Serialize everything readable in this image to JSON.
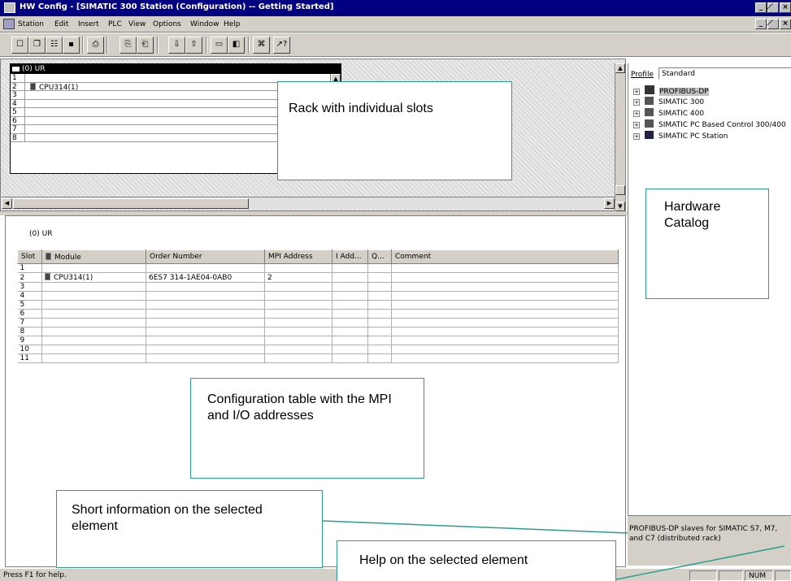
{
  "window": {
    "title": "HW Config - [SIMATIC 300 Station (Configuration) -- Getting Started]",
    "controls": [
      "_",
      "̸",
      "×"
    ]
  },
  "menu": [
    "Station",
    "Edit",
    "Insert",
    "PLC",
    "View",
    "Options",
    "Window",
    "Help"
  ],
  "toolbar": [
    {
      "icon": "new-icon",
      "glyph": "☐"
    },
    {
      "icon": "open-icon",
      "glyph": "❐"
    },
    {
      "icon": "station-icon",
      "glyph": "☷"
    },
    {
      "icon": "save-icon",
      "glyph": "▪"
    },
    {
      "icon": "print-icon",
      "glyph": "⎙"
    },
    {
      "icon": "copy-icon",
      "glyph": "⎘"
    },
    {
      "icon": "paste-icon",
      "glyph": "⎗"
    },
    {
      "icon": "download-icon",
      "glyph": "⇩"
    },
    {
      "icon": "upload-icon",
      "glyph": "⇧"
    },
    {
      "icon": "view-icon",
      "glyph": "▭"
    },
    {
      "icon": "catalog-icon",
      "glyph": "◧"
    },
    {
      "icon": "netpro-icon",
      "glyph": "⌘"
    },
    {
      "icon": "help-icon",
      "glyph": "↗?"
    }
  ],
  "rack": {
    "title": "(0) UR",
    "rows": [
      {
        "slot": "1",
        "module": ""
      },
      {
        "slot": "2",
        "module": "CPU314(1)"
      },
      {
        "slot": "3",
        "module": ""
      },
      {
        "slot": "4",
        "module": ""
      },
      {
        "slot": "5",
        "module": ""
      },
      {
        "slot": "6",
        "module": ""
      },
      {
        "slot": "7",
        "module": ""
      },
      {
        "slot": "8",
        "module": ""
      }
    ]
  },
  "table": {
    "title": "(0)  UR",
    "headers": [
      "Slot",
      "Module",
      "Order Number",
      "MPI Address",
      "I Add...",
      "Q...",
      "Comment"
    ],
    "rows": [
      [
        "1",
        "",
        "",
        "",
        "",
        "",
        ""
      ],
      [
        "2",
        "CPU314(1)",
        "6ES7 314-1AE04-0AB0",
        "2",
        "",
        "",
        ""
      ],
      [
        "3",
        "",
        "",
        "",
        "",
        "",
        ""
      ],
      [
        "4",
        "",
        "",
        "",
        "",
        "",
        ""
      ],
      [
        "5",
        "",
        "",
        "",
        "",
        "",
        ""
      ],
      [
        "6",
        "",
        "",
        "",
        "",
        "",
        ""
      ],
      [
        "7",
        "",
        "",
        "",
        "",
        "",
        ""
      ],
      [
        "8",
        "",
        "",
        "",
        "",
        "",
        ""
      ],
      [
        "9",
        "",
        "",
        "",
        "",
        "",
        ""
      ],
      [
        "10",
        "",
        "",
        "",
        "",
        "",
        ""
      ],
      [
        "11",
        "",
        "",
        "",
        "",
        "",
        ""
      ]
    ]
  },
  "catalog": {
    "profile_label": "Profile",
    "profile_value": "Standard",
    "items": [
      "PROFIBUS-DP",
      "SIMATIC 300",
      "SIMATIC 400",
      "SIMATIC PC Based Control 300/400",
      "SIMATIC PC Station"
    ],
    "info": "PROFIBUS-DP slaves for SIMATIC S7, M7, and C7 (distributed rack)"
  },
  "callouts": {
    "rack": "Rack with individual slots",
    "catalog": "Hardware Catalog",
    "table": "Configuration table with the MPI and I/O addresses",
    "short_info": "Short information on the selected element",
    "help": "Help on the selected element"
  },
  "status": {
    "text": "Press F1 for help.",
    "num": "NUM"
  }
}
